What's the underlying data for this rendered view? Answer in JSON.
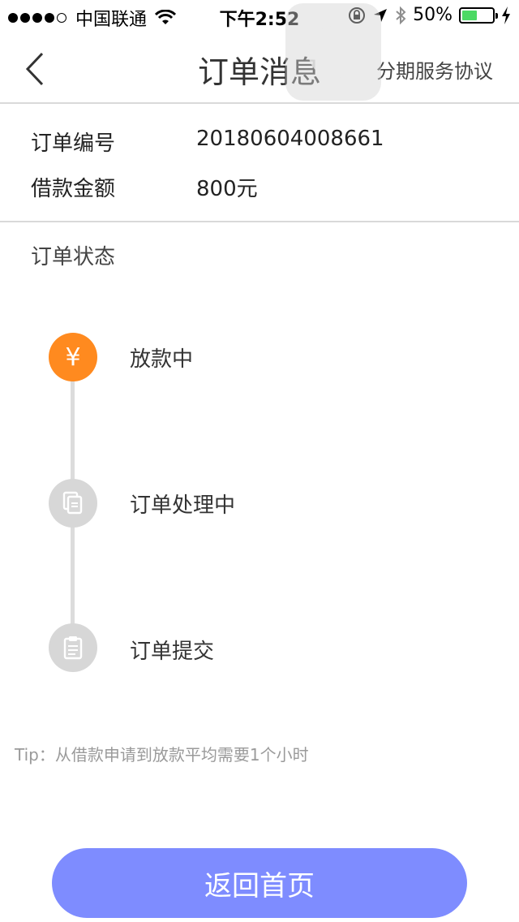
{
  "status_bar": {
    "carrier": "中国联通",
    "time": "下午2:52",
    "battery_text": "50%",
    "battery_level": 0.5,
    "battery_color": "#4cd964"
  },
  "nav": {
    "title": "订单消息",
    "right_link": "分期服务协议",
    "back_icon": "chevron-left-icon"
  },
  "order_info": {
    "rows": [
      {
        "label": "订单编号",
        "value": "20180604008661"
      },
      {
        "label": "借款金额",
        "value": "800元"
      }
    ]
  },
  "status_section": {
    "label": "订单状态",
    "steps": [
      {
        "label": "放款中",
        "state": "active",
        "icon": "yen-icon",
        "glyph": "¥"
      },
      {
        "label": "订单处理中",
        "state": "inactive",
        "icon": "documents-icon"
      },
      {
        "label": "订单提交",
        "state": "inactive",
        "icon": "clipboard-icon"
      }
    ]
  },
  "tip": "Tip：从借款申请到放款平均需要1个小时",
  "button": {
    "label": "返回首页",
    "color": "#7e8cff"
  },
  "colors": {
    "accent_orange": "#ff8a1f",
    "inactive_gray": "#d7d7d7"
  }
}
